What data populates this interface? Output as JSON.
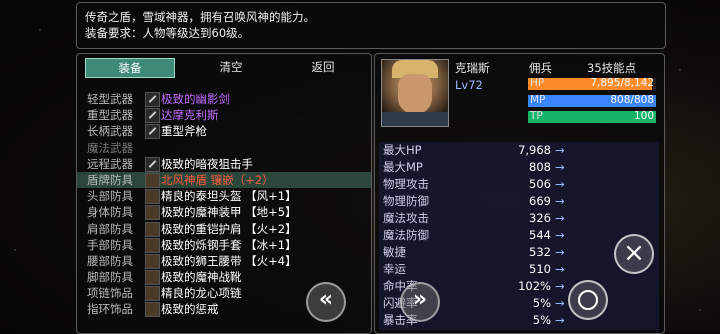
{
  "item": {
    "description": "传奇之盾，雪域神器，拥有召唤风神的能力。",
    "requirement": "装备要求：人物等级达到60级。"
  },
  "tabs": [
    {
      "label": "装备",
      "active": true
    },
    {
      "label": "清空",
      "active": false
    },
    {
      "label": "返回",
      "active": false
    }
  ],
  "slots": [
    {
      "category": "轻型武器",
      "name": "极致的幽影剑",
      "color": "#c36bff",
      "icon": "sword",
      "dim": false,
      "selected": false
    },
    {
      "category": "重型武器",
      "name": "达摩克利斯",
      "color": "#c36bff",
      "icon": "sword",
      "dim": false,
      "selected": false
    },
    {
      "category": "长柄武器",
      "name": "重型斧枪",
      "color": "#ffffff",
      "icon": "sword",
      "dim": false,
      "selected": false
    },
    {
      "category": "魔法武器",
      "name": "",
      "color": "#ffffff",
      "icon": "",
      "dim": true,
      "selected": false
    },
    {
      "category": "远程武器",
      "name": "极致的暗夜狙击手",
      "color": "#ffffff",
      "icon": "sword",
      "dim": false,
      "selected": false
    },
    {
      "category": "盾牌防具",
      "name": "北风神盾 镶嵌（+2）",
      "color": "#ff5a3c",
      "icon": "armor",
      "dim": false,
      "selected": true
    },
    {
      "category": "头部防具",
      "name": "精良的泰坦头盔 【风+1】",
      "color": "#ffffff",
      "icon": "armor",
      "dim": false,
      "selected": false
    },
    {
      "category": "身体防具",
      "name": "极致的魔神装甲 【地+5】",
      "color": "#ffffff",
      "icon": "armor",
      "dim": false,
      "selected": false
    },
    {
      "category": "肩部防具",
      "name": "极致的重铠护肩 【火+2】",
      "color": "#ffffff",
      "icon": "armor",
      "dim": false,
      "selected": false
    },
    {
      "category": "手部防具",
      "name": "极致的烁钢手套 【冰+1】",
      "color": "#ffffff",
      "icon": "armor",
      "dim": false,
      "selected": false
    },
    {
      "category": "腰部防具",
      "name": "极致的狮王腰带 【火+4】",
      "color": "#ffffff",
      "icon": "armor",
      "dim": false,
      "selected": false
    },
    {
      "category": "脚部防具",
      "name": "极致的魔神战靴",
      "color": "#ffffff",
      "icon": "armor",
      "dim": false,
      "selected": false
    },
    {
      "category": "项链饰品",
      "name": "精良的龙心项链",
      "color": "#ffffff",
      "icon": "armor",
      "dim": false,
      "selected": false
    },
    {
      "category": "指环饰品",
      "name": "极致的惩戒",
      "color": "#ffffff",
      "icon": "armor",
      "dim": false,
      "selected": false
    }
  ],
  "hero": {
    "name": "克瑞斯",
    "level": "Lv72",
    "job": "佣兵",
    "skill_points": "35技能点",
    "hp": {
      "label": "HP",
      "value": "7,895/8,142",
      "fraction": 0.97,
      "color": "#ff8a2a"
    },
    "mp": {
      "label": "MP",
      "value": "808/808",
      "fraction": 1.0,
      "color": "#3b86ff"
    },
    "tp": {
      "label": "TP",
      "value": "100",
      "fraction": 1.0,
      "color": "#16b36a"
    }
  },
  "stats": [
    {
      "label": "最大HP",
      "value": "7,968",
      "arrow": "→"
    },
    {
      "label": "最大MP",
      "value": "808",
      "arrow": "→"
    },
    {
      "label": "物理攻击",
      "value": "506",
      "arrow": "→"
    },
    {
      "label": "物理防御",
      "value": "669",
      "arrow": "→"
    },
    {
      "label": "魔法攻击",
      "value": "326",
      "arrow": "→"
    },
    {
      "label": "魔法防御",
      "value": "544",
      "arrow": "→"
    },
    {
      "label": "敏捷",
      "value": "532",
      "arrow": "→"
    },
    {
      "label": "幸运",
      "value": "510",
      "arrow": "→"
    },
    {
      "label": "命中率",
      "value": "102%",
      "arrow": "→"
    },
    {
      "label": "闪避率",
      "value": "5%",
      "arrow": "→"
    },
    {
      "label": "暴击率",
      "value": "5%",
      "arrow": "→"
    }
  ]
}
